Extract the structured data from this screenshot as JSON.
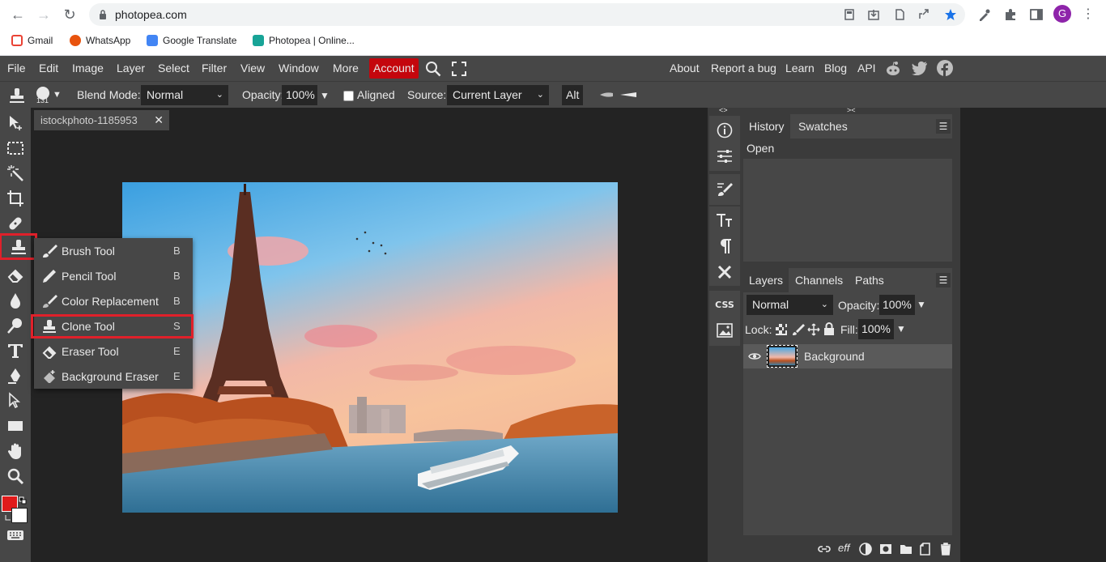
{
  "browser": {
    "url": "photopea.com",
    "profile_initial": "G",
    "bookmarks": [
      "Gmail",
      "WhatsApp",
      "Google Translate",
      "Photopea | Online..."
    ]
  },
  "menubar": {
    "items": [
      "File",
      "Edit",
      "Image",
      "Layer",
      "Select",
      "Filter",
      "View",
      "Window",
      "More"
    ],
    "account": "Account",
    "right_links": [
      "About",
      "Report a bug",
      "Learn",
      "Blog",
      "API"
    ]
  },
  "options": {
    "brush_size": "131",
    "blend_mode_label": "Blend Mode:",
    "blend_mode": "Normal",
    "opacity_label": "Opacity:",
    "opacity": "100%",
    "aligned_label": "Aligned",
    "aligned_checked": false,
    "source_label": "Source:",
    "source": "Current Layer",
    "alt_label": "Alt"
  },
  "document": {
    "tab_title": "istockphoto-1185953",
    "close_label": "✕"
  },
  "flyout": {
    "items": [
      {
        "label": "Brush Tool",
        "key": "B"
      },
      {
        "label": "Pencil Tool",
        "key": "B"
      },
      {
        "label": "Color Replacement",
        "key": "B"
      },
      {
        "label": "Clone Tool",
        "key": "S",
        "selected": true
      },
      {
        "label": "Eraser Tool",
        "key": "E"
      },
      {
        "label": "Background Eraser",
        "key": "E"
      }
    ]
  },
  "history": {
    "tabs": [
      "History",
      "Swatches"
    ],
    "entries": [
      "Open"
    ]
  },
  "layers": {
    "tabs": [
      "Layers",
      "Channels",
      "Paths"
    ],
    "blend": "Normal",
    "opacity_label": "Opacity:",
    "opacity": "100%",
    "lock_label": "Lock:",
    "fill_label": "Fill:",
    "fill": "100%",
    "items": [
      {
        "name": "Background",
        "visible": true
      }
    ]
  },
  "colors": {
    "accent_red": "#e0202a",
    "foreground": "#e01a1a",
    "background": "#ffffff",
    "panel": "#474747",
    "workspace": "#232323"
  }
}
